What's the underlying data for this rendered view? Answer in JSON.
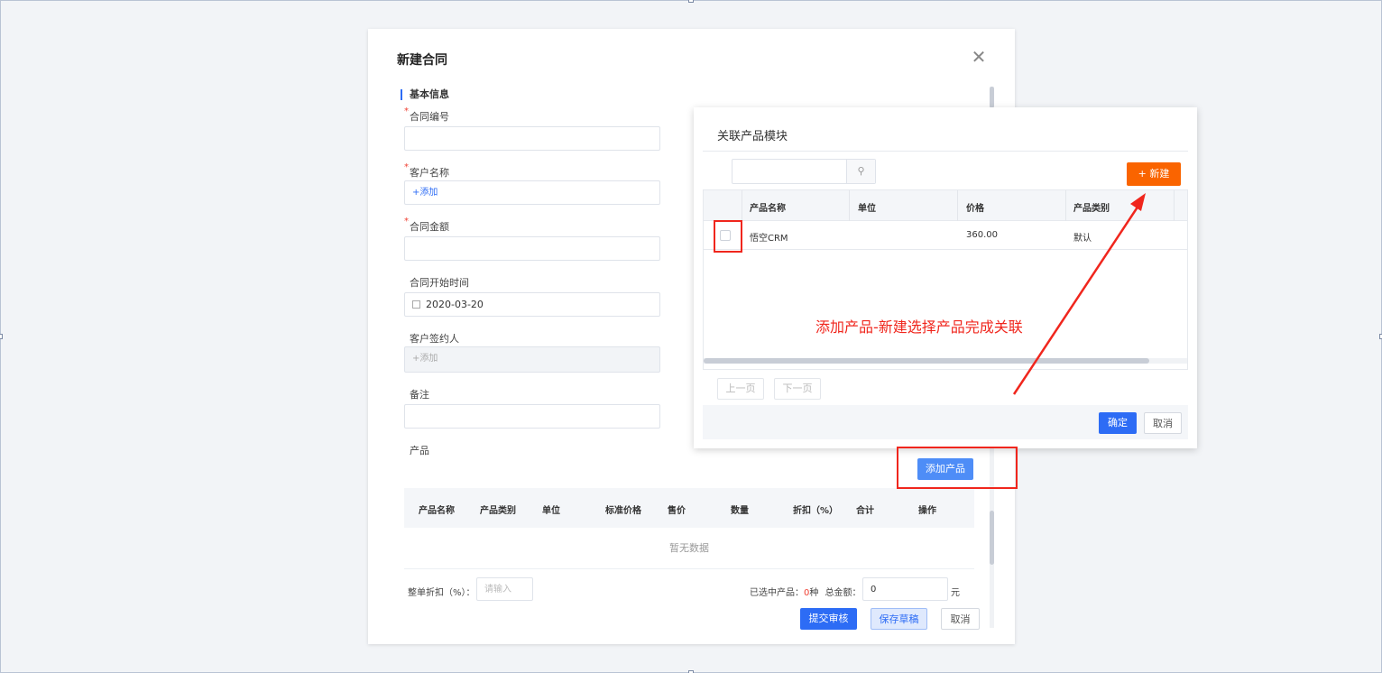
{
  "dialog": {
    "title": "新建合同",
    "section": "基本信息",
    "fields": {
      "contract_no": {
        "label": "合同编号",
        "value": ""
      },
      "customer": {
        "label": "客户名称",
        "value": "+添加"
      },
      "amount": {
        "label": "合同金额",
        "value": ""
      },
      "start_date": {
        "label": "合同开始时间",
        "value": "2020-03-20"
      },
      "signer": {
        "label": "客户签约人",
        "value": "+添加"
      },
      "remark": {
        "label": "备注",
        "value": ""
      },
      "product": {
        "label": "产品"
      }
    },
    "add_product_label": "添加产品",
    "product_table": {
      "columns": [
        "产品名称",
        "产品类别",
        "单位",
        "标准价格",
        "售价",
        "数量",
        "折扣（%）",
        "合计",
        "操作"
      ],
      "empty_text": "暂无数据"
    },
    "discount_label": "整单折扣（%）：",
    "discount_placeholder": "请输入",
    "selected_label": "已选中产品：",
    "selected_count": "0",
    "selected_unit": "种",
    "total_label": "总金额：",
    "total_value": "0",
    "total_unit": "元",
    "submit_label": "提交审核",
    "draft_label": "保存草稿",
    "cancel_label": "取消"
  },
  "popup": {
    "title": "关联产品模块",
    "search_placeholder": "",
    "new_label": "+ 新建",
    "columns": [
      "产品名称",
      "单位",
      "价格",
      "产品类别"
    ],
    "rows": [
      {
        "name": "悟空CRM",
        "unit": "",
        "price": "360.00",
        "category": "默认"
      }
    ],
    "prev_label": "上一页",
    "next_label": "下一页",
    "confirm_label": "确定",
    "cancel_label": "取消"
  },
  "annotation": {
    "text": "添加产品-新建选择产品完成关联",
    "color": "#f0261d"
  },
  "colors": {
    "primary": "#2d6cf5",
    "new_button": "#fa6400",
    "required": "#f04134"
  }
}
